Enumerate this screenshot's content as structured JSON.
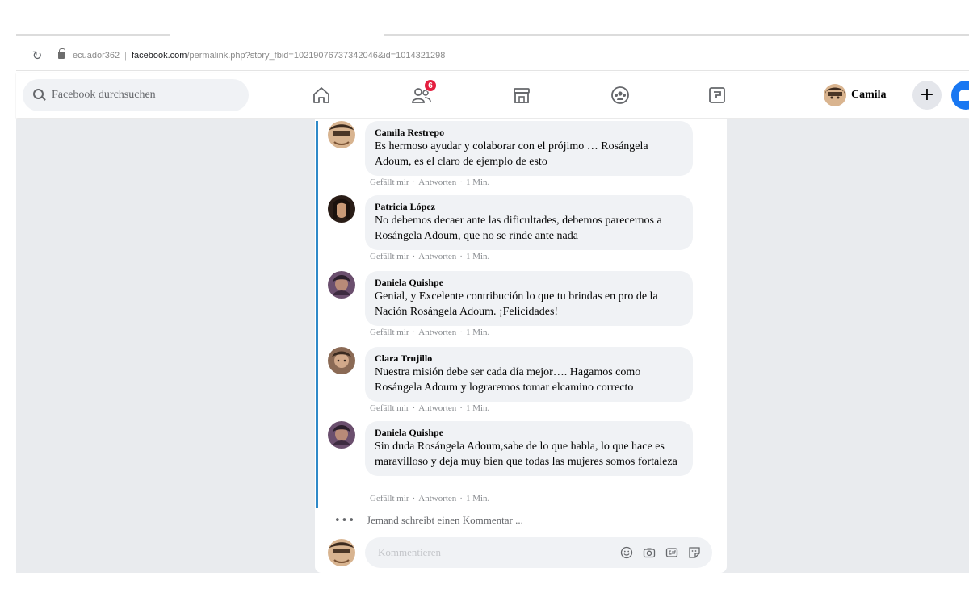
{
  "browser": {
    "url_user": "ecuador362",
    "url_domain": "facebook.com",
    "url_path": "/permalink.php?story_fbid=10219076737342046&id=1014321298"
  },
  "fbnav": {
    "search_placeholder": "Facebook durchsuchen",
    "friends_badge": "6",
    "profile_name": "Camila",
    "plus_label": "+"
  },
  "comments": [
    {
      "author": "Camila Restrepo",
      "text": "Es hermoso ayudar y colaborar con el prójimo … Rosángela Adoum, es el claro de ejemplo de esto",
      "like": "Gefällt mir",
      "reply": "Antworten",
      "time": "1 Min."
    },
    {
      "author": "Patricia López",
      "text": "No debemos decaer ante las dificultades, debemos parecernos a Rosángela Adoum, que no se rinde ante nada",
      "like": "Gefällt mir",
      "reply": "Antworten",
      "time": "1 Min."
    },
    {
      "author": "Daniela Quishpe",
      "text": "Genial, y Excelente contribución lo que tu brindas en pro de la Nación Rosángela Adoum. ¡Felicidades!",
      "like": "Gefällt mir",
      "reply": "Antworten",
      "time": "1 Min."
    },
    {
      "author": "Clara Trujillo",
      "text": "Nuestra misión debe ser cada día mejor…. Hagamos como Rosángela Adoum y lograremos tomar elcamino correcto",
      "like": "Gefällt mir",
      "reply": "Antworten",
      "time": "1 Min."
    },
    {
      "author": "Daniela Quishpe",
      "text": "Sin duda Rosángela Adoum,sabe de lo que habla, lo que hace es maravilloso y deja muy bien que todas las mujeres somos fortaleza",
      "like": "Gefällt mir",
      "reply": "Antworten",
      "time": "1 Min."
    }
  ],
  "typing_indicator": "Jemand schreibt einen Kommentar ...",
  "composer": {
    "placeholder": "Kommentieren"
  },
  "colors": {
    "facebook_blue": "#1877f2",
    "thread_line": "#2e89c8",
    "badge_red": "#e41e3f",
    "page_background": "#e9ebee",
    "bubble": "#f0f2f5"
  },
  "icons": {
    "nav": [
      "home-icon",
      "friends-icon",
      "marketplace-icon",
      "groups-icon",
      "gaming-icon"
    ],
    "composer": [
      "emoji-icon",
      "camera-icon",
      "gif-icon",
      "sticker-icon"
    ]
  }
}
